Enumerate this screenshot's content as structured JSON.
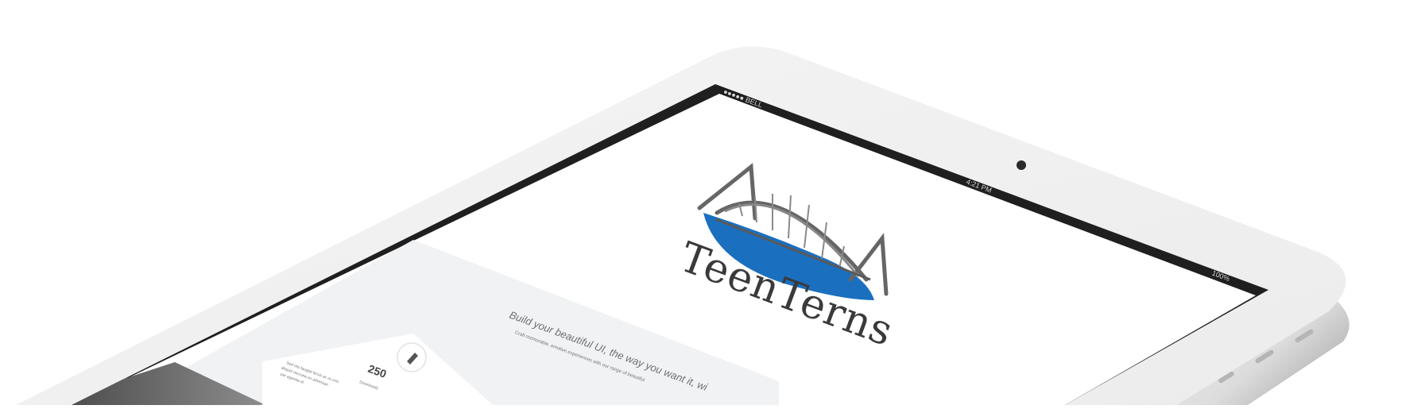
{
  "status_bar": {
    "carrier": "●●●●● BELL",
    "time": "4:21 PM",
    "battery": "100%"
  },
  "logo": {
    "wordmark": "TeenTerns",
    "colors": {
      "water": "#1a6fbf",
      "bridge": "#6a6a6a"
    }
  },
  "hero": {
    "headline": "Build your beautiful UI, the way you want it, wi",
    "subheadline": "Craft memorable, emotive experiences with our range of beautiful"
  },
  "stat": {
    "icon": "pen-icon",
    "value": "250",
    "label": "Downloads"
  },
  "body_text": [
    "Sed nisi faugiat lacus ac ut crec",
    "aliquet necrune ex adversari",
    "per agenda et"
  ],
  "device_colors": {
    "frame": "#f3f3f3",
    "bezel": "#1f1f1f",
    "screen": "#ffffff",
    "band": "#f1f2f4",
    "photo": "#7a7a7a"
  }
}
